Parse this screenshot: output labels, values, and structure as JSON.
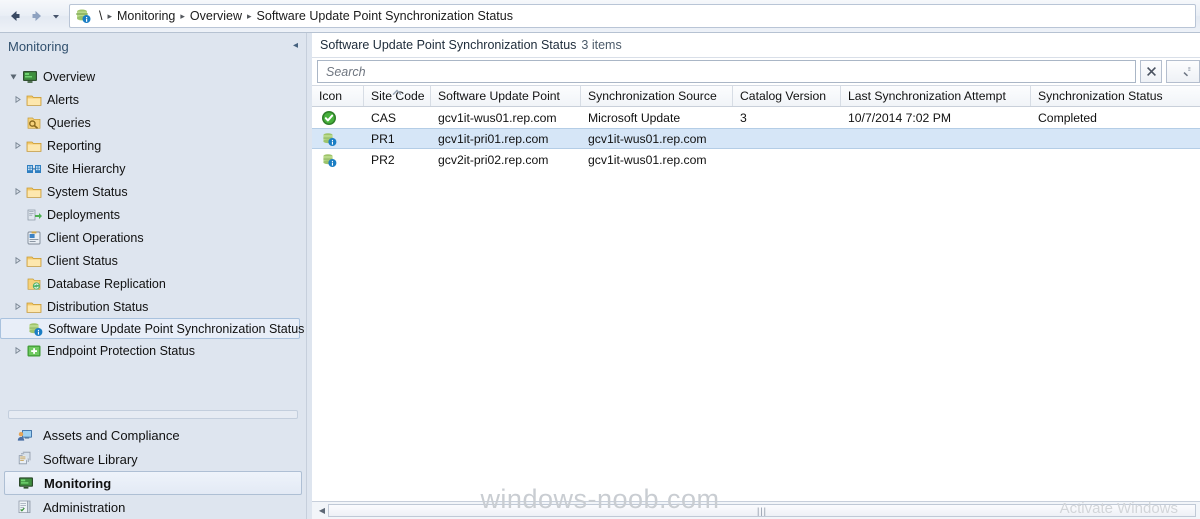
{
  "nav": {
    "back_label": "Back",
    "forward_label": "Forward",
    "history_label": "Recent locations",
    "breadcrumb": [
      {
        "label": "\\"
      },
      {
        "label": "Monitoring"
      },
      {
        "label": "Overview"
      },
      {
        "label": "Software Update Point Synchronization Status"
      }
    ],
    "separator": "▸"
  },
  "sidebar": {
    "title": "Monitoring",
    "collapse_label": "◂",
    "tree": [
      {
        "label": "Overview",
        "depth": 0,
        "expander": "expanded",
        "icon": "overview-icon",
        "selected": false
      },
      {
        "label": "Alerts",
        "depth": 1,
        "expander": "collapsed",
        "icon": "folder-icon",
        "selected": false
      },
      {
        "label": "Queries",
        "depth": 1,
        "expander": "none",
        "icon": "queries-icon",
        "selected": false
      },
      {
        "label": "Reporting",
        "depth": 1,
        "expander": "collapsed",
        "icon": "folder-icon",
        "selected": false
      },
      {
        "label": "Site Hierarchy",
        "depth": 1,
        "expander": "none",
        "icon": "site-hierarchy-icon",
        "selected": false
      },
      {
        "label": "System Status",
        "depth": 1,
        "expander": "collapsed",
        "icon": "folder-icon",
        "selected": false
      },
      {
        "label": "Deployments",
        "depth": 1,
        "expander": "none",
        "icon": "deployments-icon",
        "selected": false
      },
      {
        "label": "Client Operations",
        "depth": 1,
        "expander": "none",
        "icon": "client-operations-icon",
        "selected": false
      },
      {
        "label": "Client Status",
        "depth": 1,
        "expander": "collapsed",
        "icon": "folder-icon",
        "selected": false
      },
      {
        "label": "Database Replication",
        "depth": 1,
        "expander": "none",
        "icon": "database-replication-icon",
        "selected": false
      },
      {
        "label": "Distribution Status",
        "depth": 1,
        "expander": "collapsed",
        "icon": "folder-icon",
        "selected": false
      },
      {
        "label": "Software Update Point Synchronization Status",
        "depth": 1,
        "expander": "none",
        "icon": "sync-status-icon",
        "selected": true
      },
      {
        "label": "Endpoint Protection Status",
        "depth": 1,
        "expander": "collapsed",
        "icon": "endpoint-protection-icon",
        "selected": false
      }
    ],
    "workspaces": [
      {
        "label": "Assets and Compliance",
        "icon": "assets-compliance-icon",
        "selected": false
      },
      {
        "label": "Software Library",
        "icon": "software-library-icon",
        "selected": false
      },
      {
        "label": "Monitoring",
        "icon": "monitoring-icon",
        "selected": true
      },
      {
        "label": "Administration",
        "icon": "administration-icon",
        "selected": false
      }
    ]
  },
  "main": {
    "title": "Software Update Point Synchronization Status",
    "item_count": "3 items",
    "search": {
      "placeholder": "Search",
      "value": "",
      "clear_label": "✕",
      "search_label": "Search"
    },
    "grid": {
      "sort_column": "Site Code",
      "columns": [
        {
          "key": "icon",
          "label": "Icon"
        },
        {
          "key": "site_code",
          "label": "Site Code"
        },
        {
          "key": "software_update_point",
          "label": "Software Update Point"
        },
        {
          "key": "synchronization_source",
          "label": "Synchronization Source"
        },
        {
          "key": "catalog_version",
          "label": "Catalog Version"
        },
        {
          "key": "last_synchronization_attempt",
          "label": "Last Synchronization Attempt"
        },
        {
          "key": "synchronization_status",
          "label": "Synchronization Status"
        }
      ],
      "rows": [
        {
          "status_icon": "success-check-icon",
          "site_code": "CAS",
          "software_update_point": "gcv1it-wus01.rep.com",
          "synchronization_source": "Microsoft Update",
          "catalog_version": "3",
          "last_synchronization_attempt": "10/7/2014 7:02 PM",
          "synchronization_status": "Completed",
          "selected": false
        },
        {
          "status_icon": "sync-point-icon",
          "site_code": "PR1",
          "software_update_point": "gcv1it-pri01.rep.com",
          "synchronization_source": "gcv1it-wus01.rep.com",
          "catalog_version": "",
          "last_synchronization_attempt": "",
          "synchronization_status": "",
          "selected": true
        },
        {
          "status_icon": "sync-point-icon",
          "site_code": "PR2",
          "software_update_point": "gcv2it-pri02.rep.com",
          "synchronization_source": "gcv1it-wus01.rep.com",
          "catalog_version": "",
          "last_synchronization_attempt": "",
          "synchronization_status": "",
          "selected": false
        }
      ]
    }
  },
  "watermarks": {
    "site": "windows-noob.com",
    "activate": "Activate Windows"
  },
  "colors": {
    "sidebar_bg": "#dee5ef",
    "selection_blue": "#d6e6f7",
    "success_green": "#3f9c35",
    "accent_blue": "#2a6099"
  }
}
